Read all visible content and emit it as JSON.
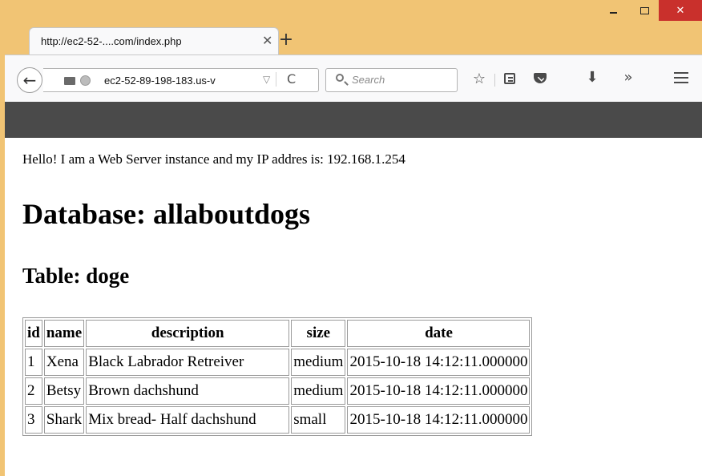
{
  "window_controls": {
    "minimize": "minimize-icon",
    "maximize": "maximize-icon",
    "close": "close-icon",
    "close_glyph": "✕"
  },
  "tab": {
    "title": "http://ec2-52-....com/index.php",
    "close_glyph": "✕",
    "new_tab_glyph": "+"
  },
  "navbar": {
    "back_glyph": "←",
    "url": "ec2-52-89-198-183.us-v",
    "url_dropdown_glyph": "▽",
    "reload_glyph": "C",
    "search_placeholder": "Search",
    "bookmark_glyph": "☆",
    "download_glyph": "🠗",
    "overflow_glyph": "»"
  },
  "page": {
    "hello_text": "Hello! I am a Web Server instance and my IP addres is: 192.168.1.254",
    "database_heading": "Database: allaboutdogs",
    "table_heading": "Table: doge",
    "table": {
      "headers": [
        "id",
        "name",
        "description",
        "size",
        "date"
      ],
      "rows": [
        [
          "1",
          "Xena",
          "Black Labrador Retreiver",
          "medium",
          "2015-10-18 14:12:11.000000"
        ],
        [
          "2",
          "Betsy",
          "Brown dachshund",
          "medium",
          "2015-10-18 14:12:11.000000"
        ],
        [
          "3",
          "Shark",
          "Mix bread- Half dachshund",
          "small",
          "2015-10-18 14:12:11.000000"
        ]
      ]
    }
  },
  "colors": {
    "window_frame": "#f1c474",
    "close_button": "#c9302c",
    "toolbar_dark": "#4a4a4a"
  }
}
